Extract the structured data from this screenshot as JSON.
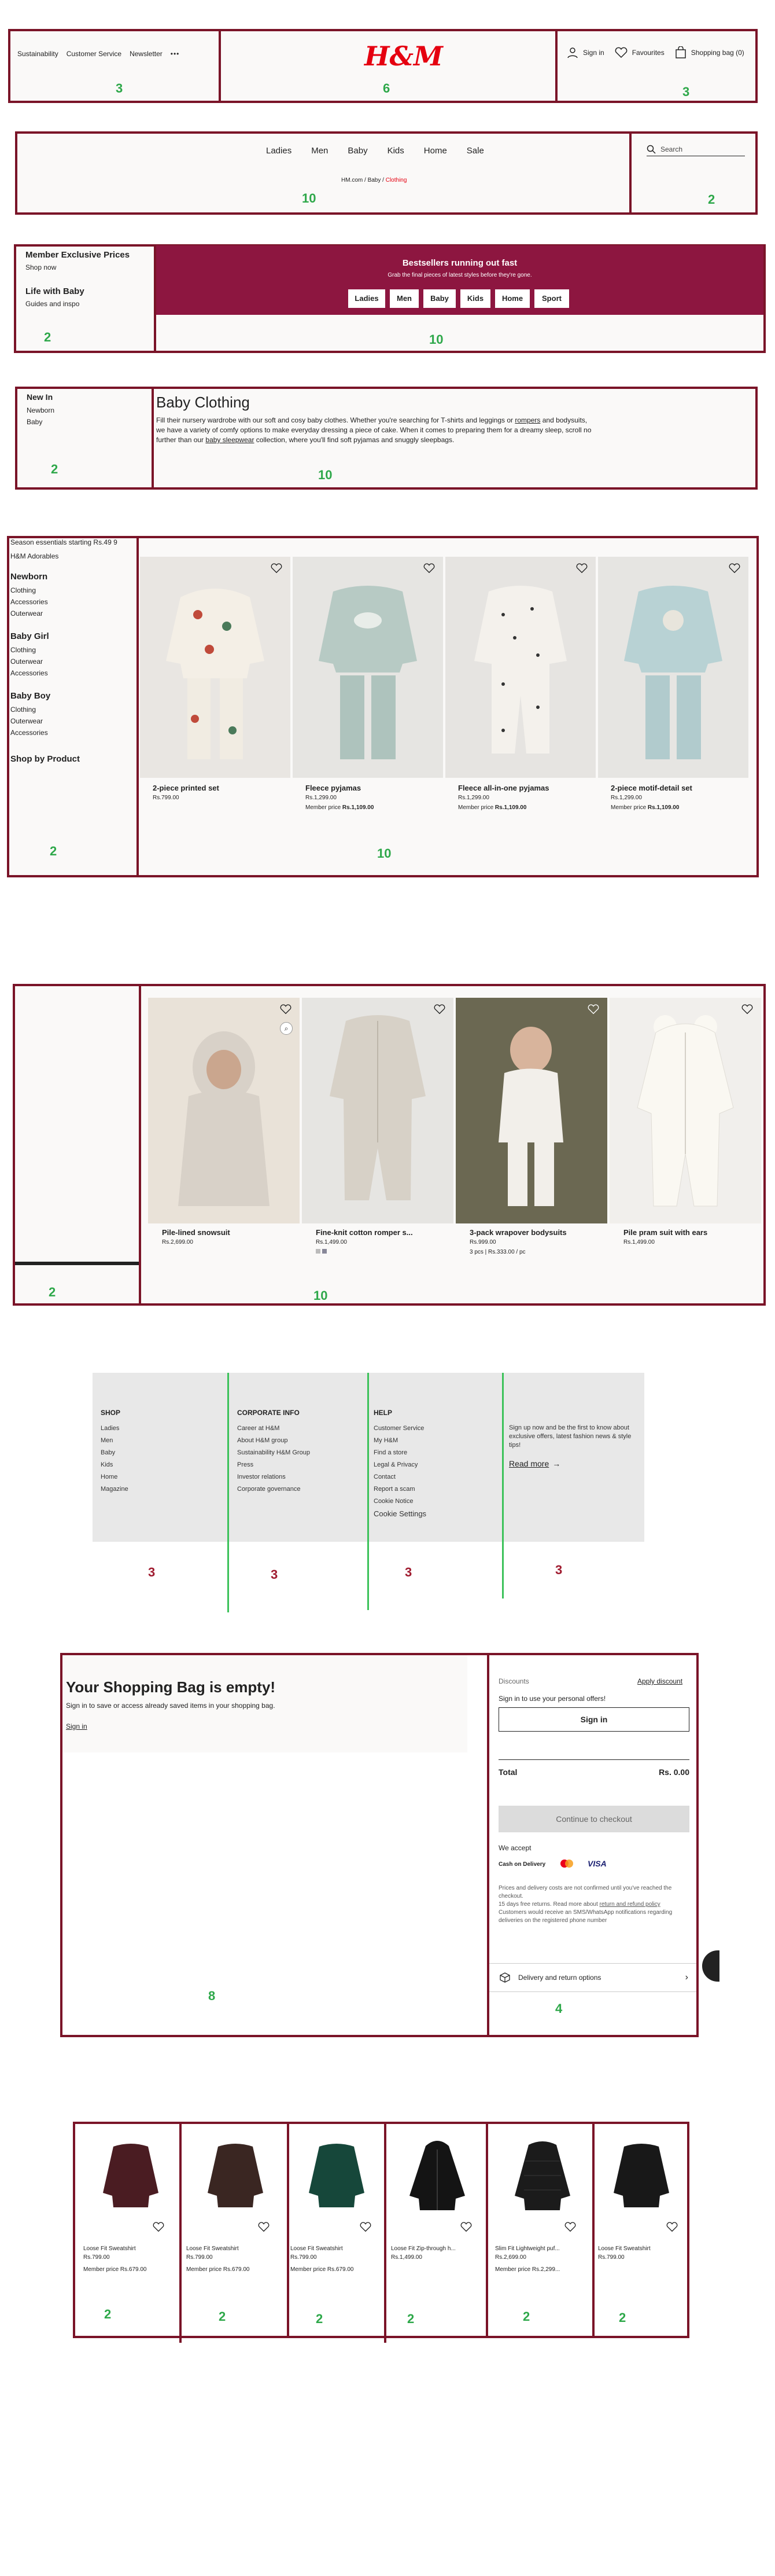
{
  "colors": {
    "frame": "#7a1428",
    "label_green": "#2ea84a",
    "label_red": "#a01c30",
    "banner": "#8d1640",
    "brand_red": "#e50010"
  },
  "header": {
    "left_links": [
      "Sustainability",
      "Customer Service",
      "Newsletter"
    ],
    "more_icon": "ellipsis-icon",
    "logo": "H&M",
    "sign_in": "Sign in",
    "favourites": "Favourites",
    "shopping_bag": "Shopping bag (0)",
    "labels": [
      "3",
      "6",
      "3"
    ]
  },
  "nav": {
    "items": [
      "Ladies",
      "Men",
      "Baby",
      "Kids",
      "Home",
      "Sale"
    ],
    "breadcrumb": [
      "HM.com",
      "Baby",
      "Clothing"
    ],
    "search_placeholder": "Search",
    "labels": [
      "10",
      "2"
    ]
  },
  "promo": {
    "side_items": [
      {
        "title": "Member Exclusive Prices",
        "sub": "Shop now"
      },
      {
        "title": "Life with Baby",
        "sub": "Guides and inspo"
      }
    ],
    "banner_title": "Bestsellers running out fast",
    "banner_sub": "Grab the final pieces of latest styles before they're gone.",
    "banner_buttons": [
      "Ladies",
      "Men",
      "Baby",
      "Kids",
      "Home",
      "Sport"
    ],
    "labels": [
      "2",
      "10"
    ]
  },
  "intro": {
    "side_items": [
      "New In",
      "Newborn",
      "Baby"
    ],
    "title": "Baby Clothing",
    "text_1": "Fill their nursery wardrobe with our soft and cosy baby clothes. Whether you're searching for T-shirts and leggings or ",
    "link_1": "rompers",
    "text_2": " and bodysuits, we have a variety of comfy options to make everyday dressing a piece of cake. When it comes to preparing them for a dreamy sleep, scroll no further than our ",
    "link_2": "baby sleepwear",
    "text_3": " collection, where you'll find soft pyjamas and snuggly sleepbags.",
    "labels": [
      "2",
      "10"
    ]
  },
  "catalog": {
    "sidebar_top": "Season essentials starting Rs.49 9",
    "sidebar_sub": "H&M Adorables",
    "groups": [
      {
        "title": "Newborn",
        "items": [
          "Clothing",
          "Accessories",
          "Outerwear"
        ]
      },
      {
        "title": "Baby Girl",
        "items": [
          "Clothing",
          "Outerwear",
          "Accessories"
        ]
      },
      {
        "title": "Baby Boy",
        "items": [
          "Clothing",
          "Outerwear",
          "Accessories"
        ]
      }
    ],
    "shop_by": "Shop by Product",
    "products": [
      {
        "name": "2-piece printed set",
        "price": "Rs.799.00",
        "member_label": "",
        "member_price": ""
      },
      {
        "name": "Fleece pyjamas",
        "price": "Rs.1,299.00",
        "member_label": "Member price",
        "member_price": "Rs.1,109.00"
      },
      {
        "name": "Fleece all-in-one pyjamas",
        "price": "Rs.1,299.00",
        "member_label": "Member price",
        "member_price": "Rs.1,109.00"
      },
      {
        "name": "2-piece motif-detail set",
        "price": "Rs.1,299.00",
        "member_label": "Member price",
        "member_price": "Rs.1,109.00"
      }
    ],
    "labels": [
      "2",
      "10"
    ]
  },
  "catalog2": {
    "products": [
      {
        "name": "Pile-lined snowsuit",
        "price": "Rs.2,699.00",
        "extra": ""
      },
      {
        "name": "Fine-knit cotton romper s...",
        "price": "Rs.1,499.00",
        "extra": ""
      },
      {
        "name": "3-pack wrapover bodysuits",
        "price": "Rs.999.00",
        "extra": "3 pcs | Rs.333.00 / pc"
      },
      {
        "name": "Pile pram suit with ears",
        "price": "Rs.1,499.00",
        "extra": ""
      }
    ],
    "labels": [
      "2",
      "10"
    ]
  },
  "footer": {
    "columns": [
      {
        "title": "SHOP",
        "links": [
          "Ladies",
          "Men",
          "Baby",
          "Kids",
          "Home",
          "Magazine"
        ]
      },
      {
        "title": "CORPORATE INFO",
        "links": [
          "Career at H&M",
          "About H&M group",
          "Sustainability H&M Group",
          "Press",
          "Investor relations",
          "Corporate governance"
        ]
      },
      {
        "title": "HELP",
        "links": [
          "Customer Service",
          "My H&M",
          "Find a store",
          "Legal & Privacy",
          "Contact",
          "Report a scam",
          "Cookie Notice",
          "Cookie Settings"
        ]
      }
    ],
    "newsletter_text": "Sign up now and be the first to know about exclusive offers, latest fashion news & style tips!",
    "read_more": "Read more",
    "labels": [
      "3",
      "3",
      "3",
      "3"
    ]
  },
  "bag": {
    "title": "Your Shopping Bag is empty!",
    "subtitle": "Sign in to save or access already saved items in your shopping bag.",
    "sign_in_link": "Sign in",
    "discounts": "Discounts",
    "apply_discount": "Apply discount",
    "sign_in_note": "Sign in to use your personal offers!",
    "sign_in_button": "Sign in",
    "total_label": "Total",
    "total_value": "Rs. 0.00",
    "checkout": "Continue to checkout",
    "we_accept": "We accept",
    "cod": "Cash on Delivery",
    "visa": "VISA",
    "legal_1": "Prices and delivery costs are not confirmed until you've reached the checkout.",
    "legal_2": "15 days free returns. Read more about ",
    "legal_link": "return and refund policy",
    "legal_3": "Customers would receive an SMS/WhatsApp notifications regarding deliveries on the registered phone number",
    "delivery": "Delivery and return options",
    "labels": [
      "8",
      "4"
    ]
  },
  "recs": {
    "items": [
      {
        "name": "Loose Fit Sweatshirt",
        "price": "Rs.799.00",
        "member": "Member price Rs.679.00",
        "color": "#4a1c22"
      },
      {
        "name": "Loose Fit Sweatshirt",
        "price": "Rs.799.00",
        "member": "Member price Rs.679.00",
        "color": "#3a2622"
      },
      {
        "name": "Loose Fit Sweatshirt",
        "price": "Rs.799.00",
        "member": "Member price Rs.679.00",
        "color": "#16473a"
      },
      {
        "name": "Loose Fit Zip-through h...",
        "price": "Rs.1,499.00",
        "member": "",
        "color": "#141414"
      },
      {
        "name": "Slim Fit Lightweight puf...",
        "price": "Rs.2,699.00",
        "member": "Member price Rs.2,299...",
        "color": "#1b1b1b"
      },
      {
        "name": "Loose Fit Sweatshirt",
        "price": "Rs.799.00",
        "member": "",
        "color": "#181818"
      }
    ],
    "labels": [
      "2",
      "2",
      "2",
      "2",
      "2",
      "2"
    ]
  }
}
